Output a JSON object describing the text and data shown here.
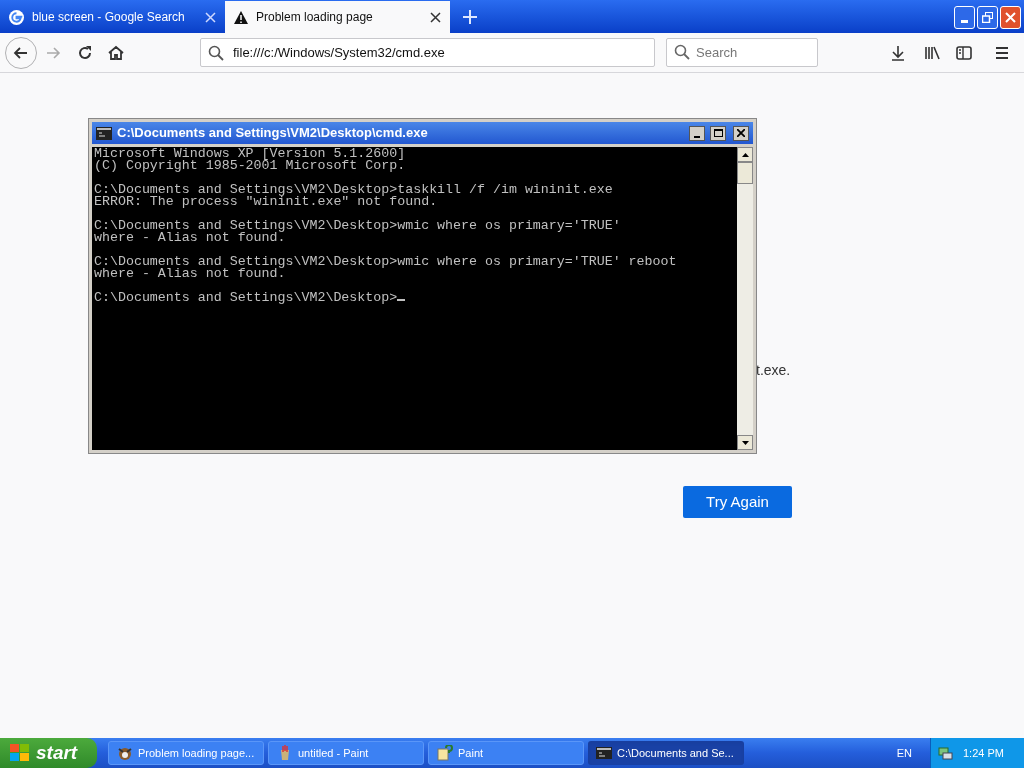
{
  "browser": {
    "tabs": [
      {
        "title": "blue screen - Google Search",
        "selected": false,
        "kind": "google"
      },
      {
        "title": "Problem loading page",
        "selected": true,
        "kind": "warning"
      }
    ],
    "address": "file:///c:/Windows/System32/cmd.exe",
    "search": {
      "placeholder": "Search"
    }
  },
  "page": {
    "partial_text": "t.exe.",
    "button": "Try Again"
  },
  "console_window": {
    "title": "C:\\Documents and Settings\\VM2\\Desktop\\cmd.exe",
    "cursor": true,
    "blocks": [
      [
        "Microsoft Windows XP [Version 5.1.2600]",
        "(C) Copyright 1985-2001 Microsoft Corp."
      ],
      [
        "C:\\Documents and Settings\\VM2\\Desktop>taskkill /f /im wininit.exe",
        "ERROR: The process \"wininit.exe\" not found."
      ],
      [
        "C:\\Documents and Settings\\VM2\\Desktop>wmic where os primary='TRUE'",
        "where - Alias not found."
      ],
      [
        "C:\\Documents and Settings\\VM2\\Desktop>wmic where os primary='TRUE' reboot",
        "where - Alias not found."
      ],
      [
        "C:\\Documents and Settings\\VM2\\Desktop>"
      ]
    ]
  },
  "taskbar": {
    "start": "start",
    "tasks": [
      {
        "label": "Problem loading page...",
        "kind": "browser",
        "selected": false
      },
      {
        "label": "untitled - Paint",
        "kind": "paint",
        "selected": false
      },
      {
        "label": "Paint",
        "kind": "help",
        "selected": false
      },
      {
        "label": "C:\\Documents and Se...",
        "kind": "console",
        "selected": true
      }
    ],
    "language": "EN",
    "clock": "1:24 PM"
  }
}
